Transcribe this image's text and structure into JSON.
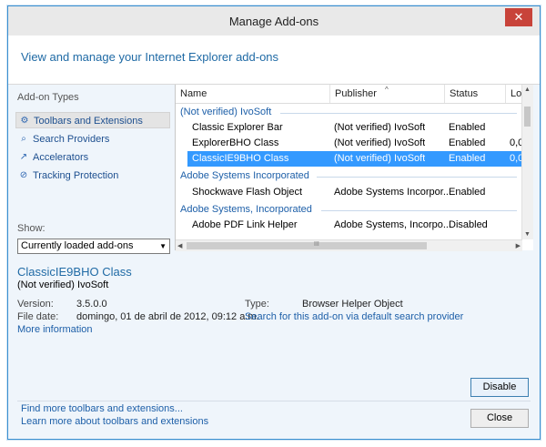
{
  "window": {
    "title": "Manage Add-ons",
    "close_glyph": "✕"
  },
  "banner": {
    "text": "View and manage your Internet Explorer add-ons"
  },
  "left_panel": {
    "section_label": "Add-on Types",
    "items": [
      {
        "label": "Toolbars and Extensions",
        "icon": "gear-icon"
      },
      {
        "label": "Search Providers",
        "icon": "search-icon"
      },
      {
        "label": "Accelerators",
        "icon": "accelerator-icon"
      },
      {
        "label": "Tracking Protection",
        "icon": "block-icon"
      }
    ],
    "show_label": "Show:",
    "show_value": "Currently loaded add-ons"
  },
  "list": {
    "columns": {
      "name": "Name",
      "publisher": "Publisher",
      "status": "Status",
      "load": "Lo"
    },
    "groups": [
      {
        "title": "(Not verified) IvoSoft",
        "rows": [
          {
            "name": "Classic Explorer Bar",
            "publisher": "(Not verified) IvoSoft",
            "status": "Enabled",
            "load": ""
          },
          {
            "name": "ExplorerBHO Class",
            "publisher": "(Not verified) IvoSoft",
            "status": "Enabled",
            "load": "0,0"
          },
          {
            "name": "ClassicIE9BHO Class",
            "publisher": "(Not verified) IvoSoft",
            "status": "Enabled",
            "load": "0,0"
          }
        ]
      },
      {
        "title": "Adobe Systems Incorporated",
        "rows": [
          {
            "name": "Shockwave Flash Object",
            "publisher": "Adobe Systems Incorpor...",
            "status": "Enabled",
            "load": ""
          }
        ]
      },
      {
        "title": "Adobe Systems, Incorporated",
        "rows": [
          {
            "name": "Adobe PDF Link Helper",
            "publisher": "Adobe Systems, Incorpo...",
            "status": "Disabled",
            "load": ""
          }
        ]
      }
    ],
    "grip": "III"
  },
  "details": {
    "name": "ClassicIE9BHO Class",
    "publisher": "(Not verified) IvoSoft",
    "version_label": "Version:",
    "version": "3.5.0.0",
    "filedate_label": "File date:",
    "filedate": "domingo, 01 de abril de 2012, 09:12 a.m.",
    "type_label": "Type:",
    "type": "Browser Helper Object",
    "search_link": "Search for this add-on via default search provider",
    "more_info": "More information",
    "disable_button": "Disable"
  },
  "footer": {
    "link1": "Find more toolbars and extensions...",
    "link2": "Learn more about toolbars and extensions",
    "close_button": "Close"
  }
}
